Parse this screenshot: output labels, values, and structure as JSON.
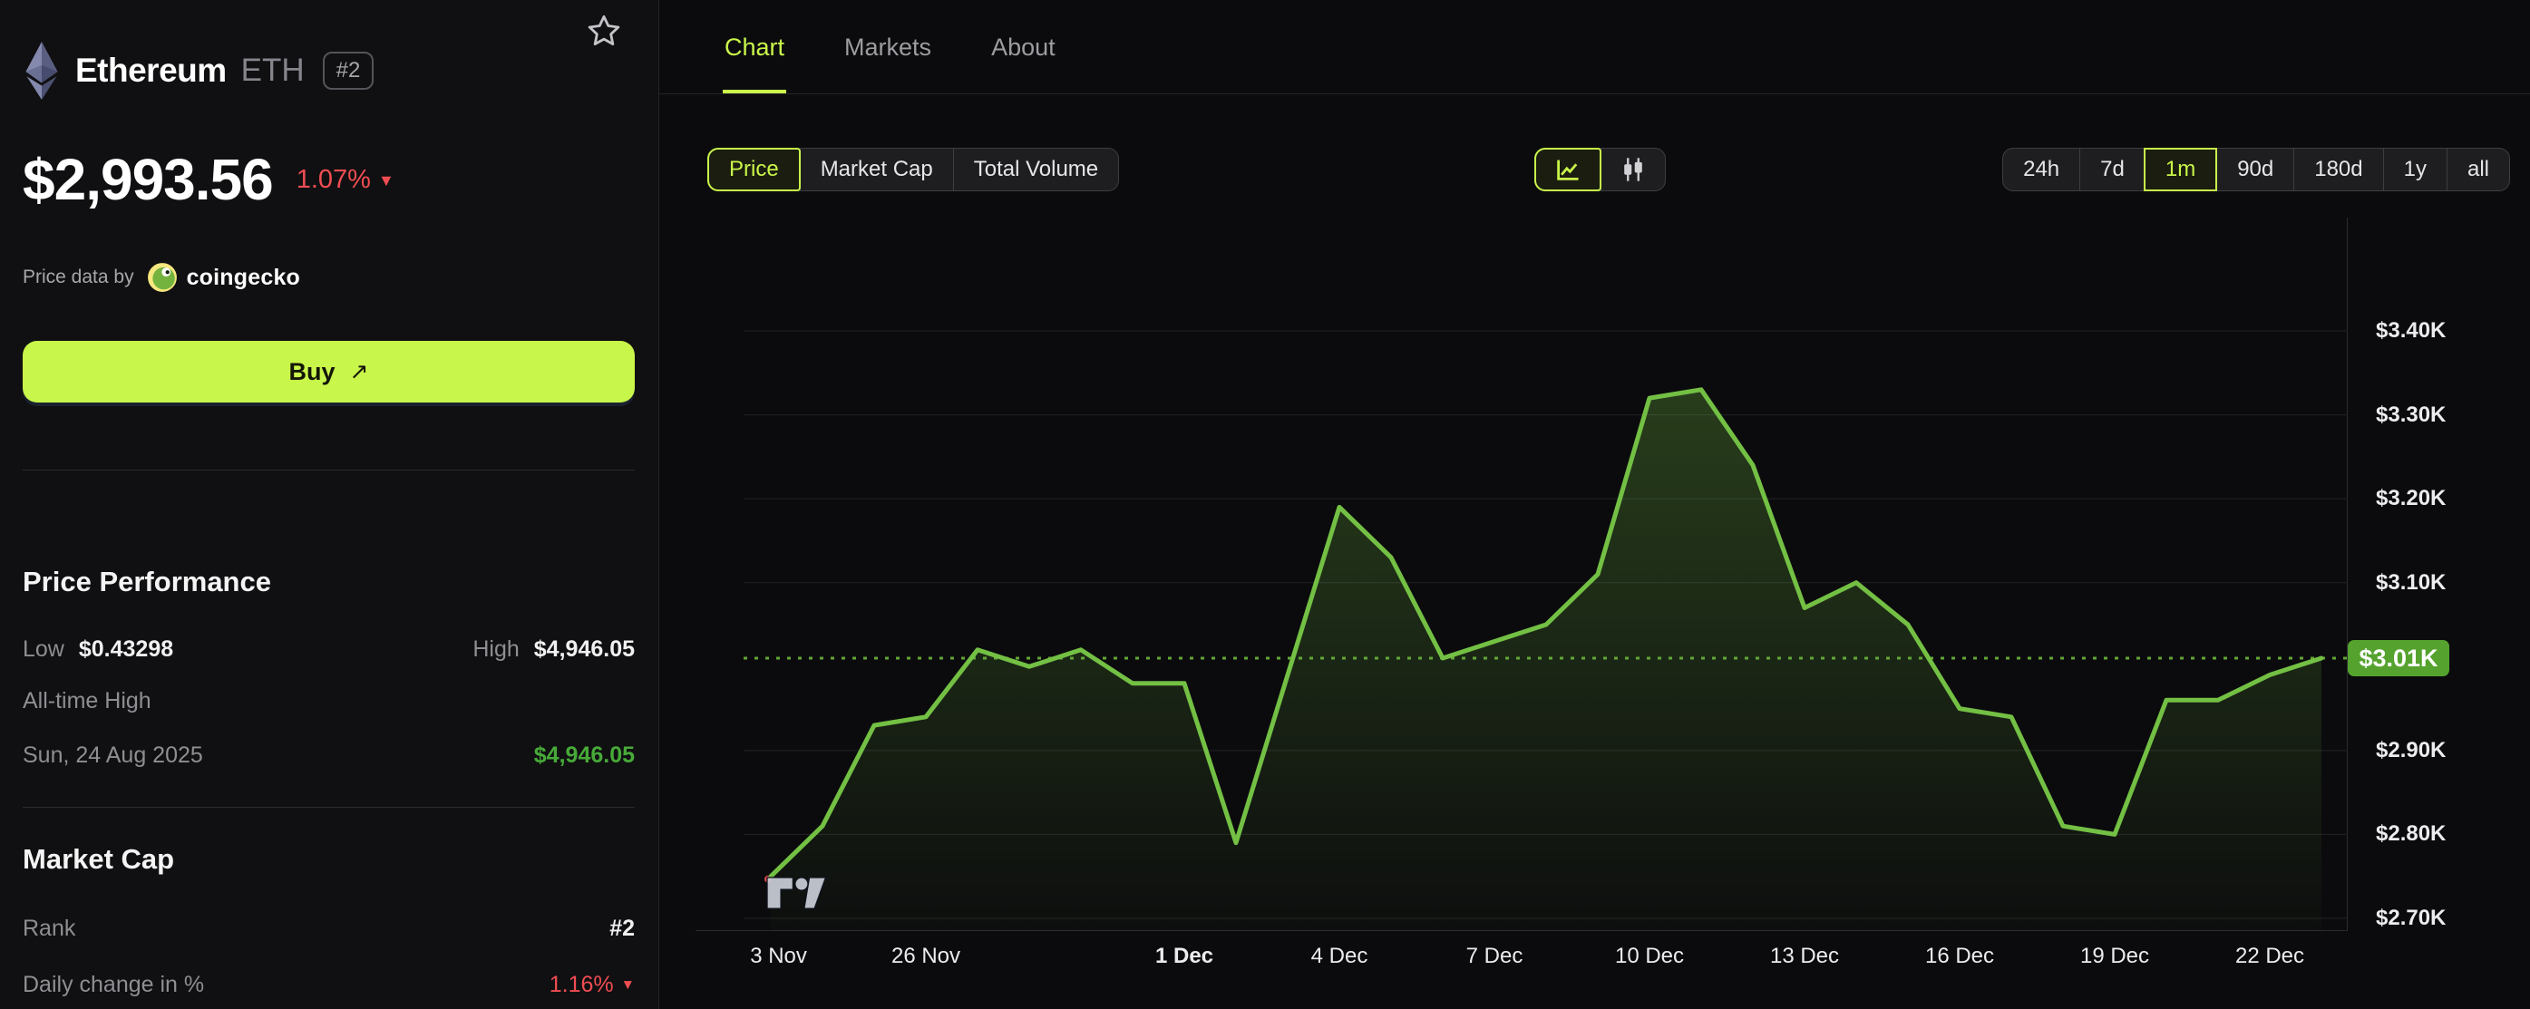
{
  "header": {
    "coin_name": "Ethereum",
    "ticker": "ETH",
    "rank_badge": "#2"
  },
  "price": {
    "value": "$2,993.56",
    "change_percent": "1.07%",
    "direction": "down"
  },
  "attribution": {
    "prefix": "Price data by",
    "provider": "coingecko"
  },
  "buy_button": {
    "label": "Buy",
    "arrow": "↗"
  },
  "price_performance": {
    "title": "Price Performance",
    "low_label": "Low",
    "low_value": "$0.43298",
    "high_label": "High",
    "high_value": "$4,946.05",
    "ath_label": "All-time High",
    "ath_date": "Sun, 24 Aug 2025",
    "ath_value": "$4,946.05"
  },
  "market_cap": {
    "title": "Market Cap",
    "rank_label": "Rank",
    "rank_value": "#2",
    "daily_change_label": "Daily change in %",
    "daily_change_value": "1.16%",
    "daily_change_direction": "down"
  },
  "tabs": [
    {
      "label": "Chart",
      "active": true
    },
    {
      "label": "Markets",
      "active": false
    },
    {
      "label": "About",
      "active": false
    }
  ],
  "metric_toggle": [
    {
      "label": "Price",
      "active": true
    },
    {
      "label": "Market Cap",
      "active": false
    },
    {
      "label": "Total Volume",
      "active": false
    }
  ],
  "chart_type_toggle": [
    {
      "name": "line-chart",
      "active": true
    },
    {
      "name": "candlestick-chart",
      "active": false
    }
  ],
  "range_buttons": [
    {
      "label": "24h",
      "active": false
    },
    {
      "label": "7d",
      "active": false
    },
    {
      "label": "1m",
      "active": true
    },
    {
      "label": "90d",
      "active": false
    },
    {
      "label": "180d",
      "active": false
    },
    {
      "label": "1y",
      "active": false
    },
    {
      "label": "all",
      "active": false
    }
  ],
  "chart_data": {
    "type": "area",
    "title": "ETH price, 1 month, USD",
    "values_usd_k": [
      2.75,
      2.81,
      2.93,
      2.94,
      3.02,
      3.0,
      3.02,
      2.98,
      2.98,
      2.79,
      2.99,
      3.19,
      3.13,
      3.01,
      3.03,
      3.05,
      3.11,
      3.32,
      3.33,
      3.24,
      3.07,
      3.1,
      3.05,
      2.95,
      2.94,
      2.81,
      2.8,
      2.96,
      2.96,
      2.99,
      3.01
    ],
    "x_unit": "day-index",
    "x_ticks": [
      {
        "label": "3 Nov",
        "day": 0.15,
        "bold": false
      },
      {
        "label": "26 Nov",
        "day": 3,
        "bold": false
      },
      {
        "label": "1 Dec",
        "day": 8,
        "bold": true
      },
      {
        "label": "4 Dec",
        "day": 11,
        "bold": false
      },
      {
        "label": "7 Dec",
        "day": 14,
        "bold": false
      },
      {
        "label": "10 Dec",
        "day": 17,
        "bold": false
      },
      {
        "label": "13 Dec",
        "day": 20,
        "bold": false
      },
      {
        "label": "16 Dec",
        "day": 23,
        "bold": false
      },
      {
        "label": "19 Dec",
        "day": 26,
        "bold": false
      },
      {
        "label": "22 Dec",
        "day": 29,
        "bold": false
      }
    ],
    "y_ticks": [
      {
        "label": "$3.40K",
        "value": 3.4
      },
      {
        "label": "$3.30K",
        "value": 3.3
      },
      {
        "label": "$3.20K",
        "value": 3.2
      },
      {
        "label": "$3.10K",
        "value": 3.1
      },
      {
        "label": "$2.90K",
        "value": 2.9
      },
      {
        "label": "$2.80K",
        "value": 2.8
      },
      {
        "label": "$2.70K",
        "value": 2.7
      }
    ],
    "ylim": [
      2.685,
      3.535
    ],
    "grid": "horizontal",
    "legend": "none",
    "current_price_label": "$3.01K",
    "current_price_value": 3.01,
    "dotted_current_price_line": true
  },
  "glyphs": {
    "down_triangle": "▼"
  },
  "colors": {
    "accent_lime": "#c9f64a",
    "chart_line_green": "#73c044",
    "price_badge_green": "#55a32e",
    "negative_red": "#ef4d52",
    "ath_green": "#47aa38"
  },
  "watermark": "TradingView"
}
